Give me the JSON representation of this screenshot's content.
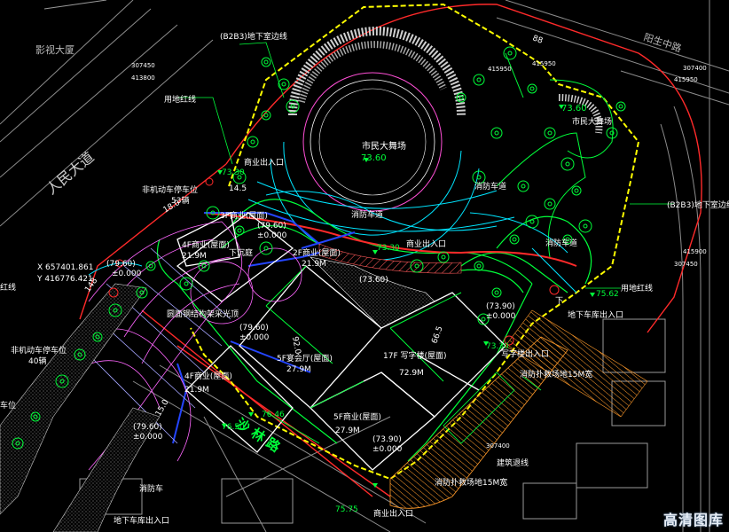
{
  "drawing": {
    "streets": {
      "north": "影视大厦",
      "west": "人民大道",
      "east": "阳生中路",
      "south": "沙 林 路"
    },
    "plaza": {
      "main_label": "市民大舞场",
      "main_elev": "73.60",
      "east_label": "市民大舞场",
      "east_elev": "73.60"
    },
    "labels": {
      "basement_line_nw": "(B2B3)地下室边线",
      "basement_line_e": "(B2B3)地下室边线",
      "red_line_nw": "用地红线",
      "red_line_e": "用地红线",
      "red_line_w": "红线",
      "fire_lane_1": "消防车道",
      "fire_lane_2": "消防车道",
      "fire_lane_3": "消防车道",
      "fire_lane_4": "消防车道",
      "commercial_entry_1": "商业出入口",
      "commercial_entry_2": "商业出入口",
      "commercial_entry_3": "商业出入口",
      "office_entry": "写字楼出入口",
      "garage_entry_e": "地下车库出入口",
      "garage_entry_s": "地下车库出入口",
      "ramp_down": "下",
      "ramp_down_2": "下沉庭",
      "bike_parking_n": "非机动车停车位",
      "bike_parking_n_count": "53辆",
      "bike_parking_w": "非机动车停车位",
      "bike_parking_w_count": "40辆",
      "bike_parking_sw": "车位",
      "rain_canopy": "圆面钢结构架采光顶",
      "fire_ground_1": "消防扑救场地15M宽",
      "fire_ground_2": "消防扑救场地15M宽",
      "building_setback": "建筑退线",
      "fire_truck": "消防车",
      "coord_x": "X 657401.861",
      "coord_y": "Y 416776.421",
      "dim_148": "148",
      "grid_1": "307450",
      "grid_2": "413800",
      "grid_3": "415950",
      "grid_4": "307400",
      "grid_5": "415950",
      "grid_6": "415900",
      "grid_7": "307450",
      "grid_8": "415950",
      "grid_9": "307400",
      "dim_145": "14.5",
      "dim_920": "92.0",
      "dim_665": "66.5",
      "dim_1800": "18.0",
      "dim_150": "15.0",
      "dim_88": "88"
    },
    "buildings": [
      {
        "name": "3F商业(屋面)",
        "height": "21.9M",
        "elev_top": "(79.60)",
        "elev_base": "±0.000"
      },
      {
        "name": "4F商业(屋面)",
        "height": "21.9M"
      },
      {
        "name": "2F商业(屋面)",
        "height": "21.9M"
      },
      {
        "name": "5F宴会厅(屋面)",
        "height": "27.9M",
        "elev_top": "(79.60)",
        "elev_base": "±0.000"
      },
      {
        "name": "17F 写字楼(屋面)",
        "height": "72.9M",
        "elev_top": "(73.90)",
        "elev_base": "±0.000"
      },
      {
        "name": "5F商业(屋面)",
        "height": "27.9M",
        "elev_top": "(73.90)",
        "elev_base": "±0.000"
      },
      {
        "name": "4F商业(屋面)",
        "height": "21.9M",
        "elev_top": "(79.60)",
        "elev_base": "±0.000"
      },
      {
        "name": "4F商业(屋面)",
        "height": "21.9M"
      }
    ],
    "elevations": {
      "e1": "73.30",
      "e2": "73.30",
      "e3": "75.62",
      "e4": "73.30",
      "e5": "76.46",
      "e6": "76.50",
      "e7": "75.75",
      "e8": "(79.60)",
      "e8b": "±0.000",
      "e9": "(73.60)"
    },
    "watermark": "高清图库"
  },
  "colors": {
    "bg": "#000000",
    "red_line": "#ff2a2a",
    "basement": "#ffff00",
    "green": "#00ff3a",
    "cyan": "#00e5ff",
    "magenta": "#ff66ff",
    "white": "#ffffff",
    "blue": "#1f3dff",
    "gray": "#9a9a9a",
    "orange": "#ff9a2a"
  }
}
